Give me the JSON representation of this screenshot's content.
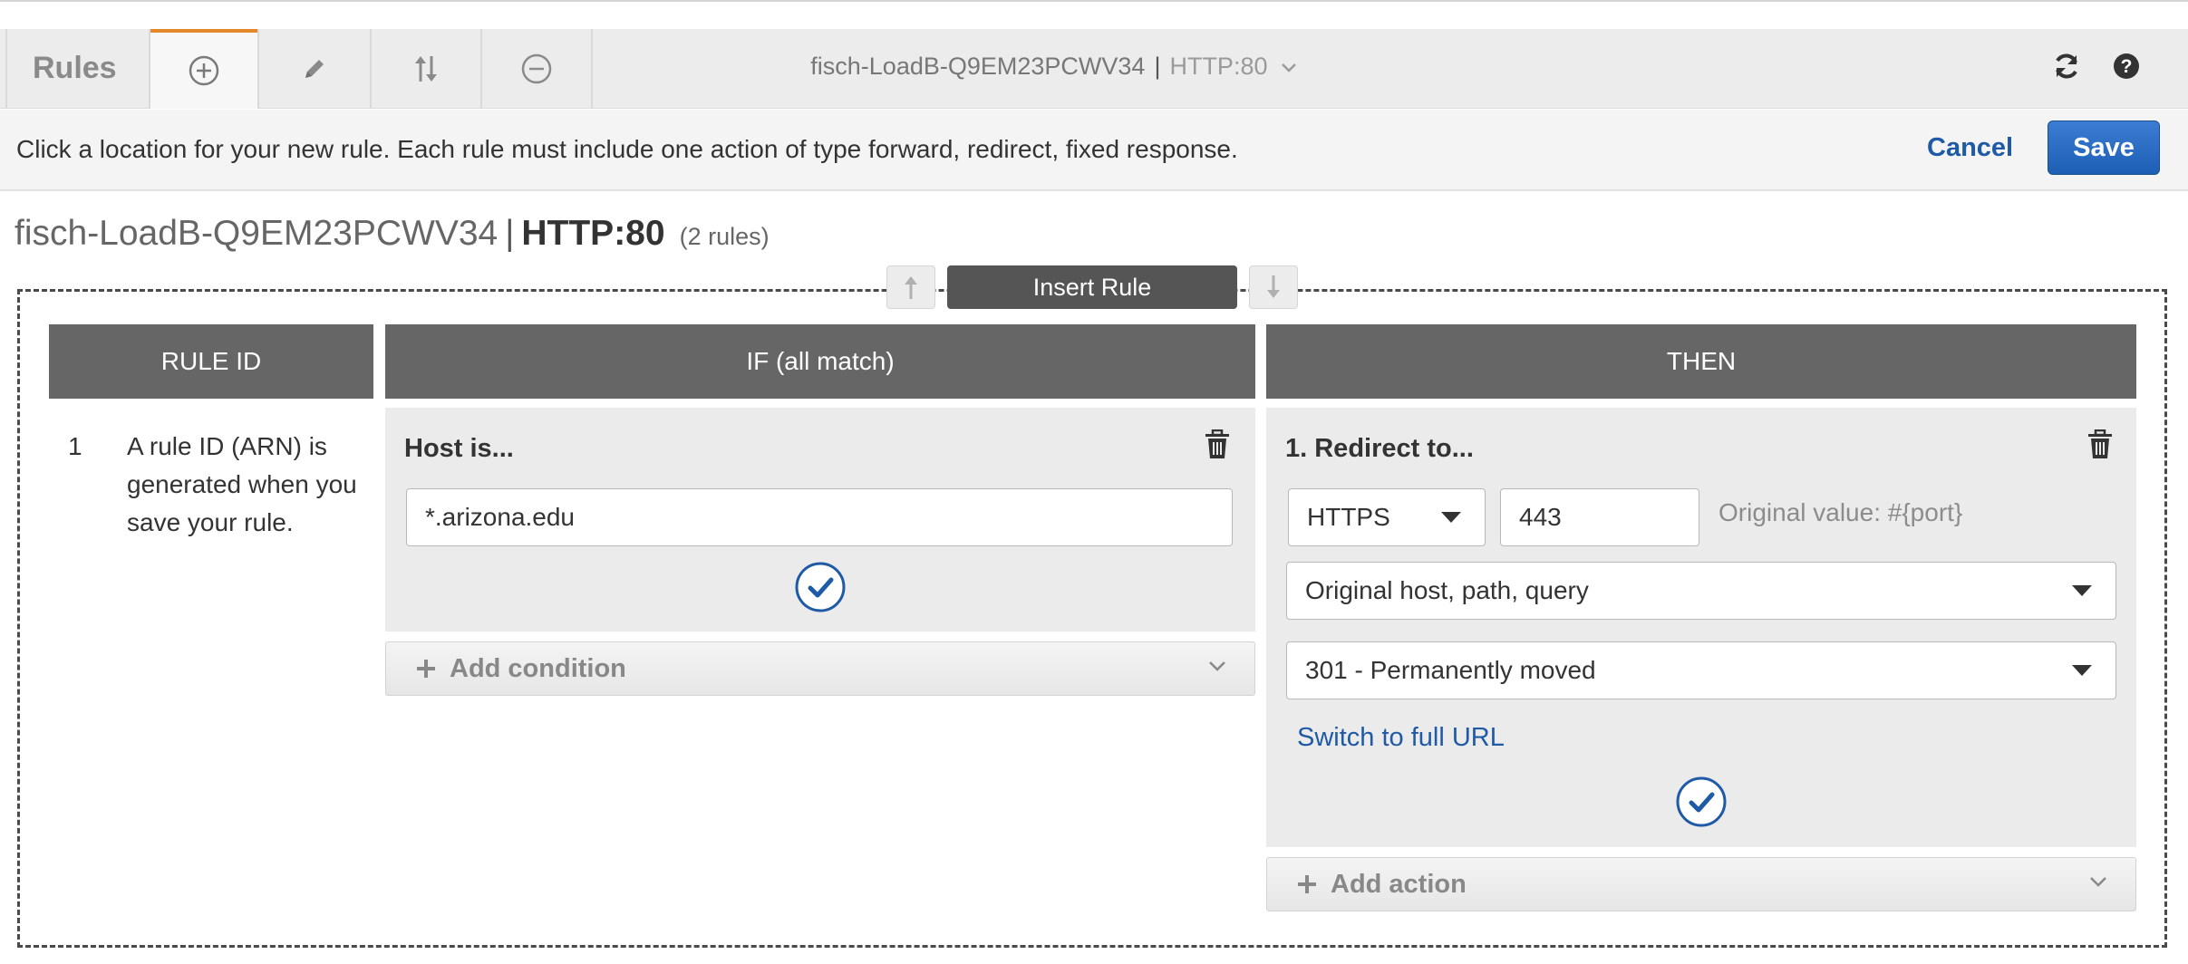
{
  "toolbar": {
    "title": "Rules",
    "load_balancer": "fisch-LoadB-Q9EM23PCWV34",
    "separator": "|",
    "listener": "HTTP:80"
  },
  "message_bar": {
    "text": "Click a location for your new rule. Each rule must include one action of type forward, redirect, fixed response.",
    "cancel_label": "Cancel",
    "save_label": "Save"
  },
  "heading": {
    "load_balancer": "fisch-LoadB-Q9EM23PCWV34",
    "separator": "|",
    "listener": "HTTP:80",
    "rule_count": "(2 rules)"
  },
  "insert_rule_label": "Insert Rule",
  "columns": {
    "rule_id": "RULE ID",
    "if": "IF (all match)",
    "then": "THEN"
  },
  "rule": {
    "number": "1",
    "id_text": "A rule ID (ARN) is generated when you save your rule."
  },
  "condition": {
    "title": "Host is...",
    "value": "*.arizona.edu",
    "add_label": "Add condition"
  },
  "action": {
    "title": "1. Redirect to...",
    "protocol": "HTTPS",
    "port": "443",
    "original_value": "Original value: #{port}",
    "host_path_query": "Original host, path, query",
    "status_code": "301 - Permanently moved",
    "switch_label": "Switch to full URL",
    "add_label": "Add action"
  },
  "colors": {
    "accent_tab": "#e4882c",
    "primary_button": "#1f5aa6",
    "link": "#1f5aa6",
    "header_bg": "#666666"
  }
}
